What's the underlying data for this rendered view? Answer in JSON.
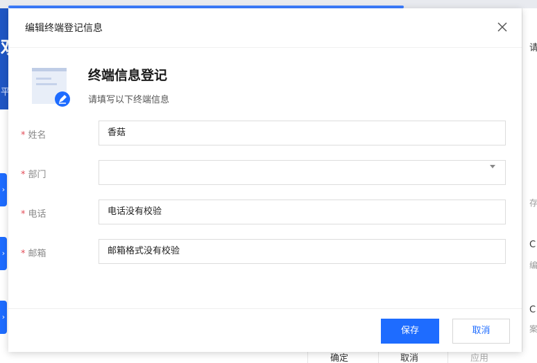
{
  "background": {
    "right_texts": [
      "请",
      "存",
      "C",
      "编",
      "C",
      "案"
    ],
    "bottom_buttons": [
      "确定",
      "取消",
      "应用"
    ],
    "blue_panel_chars": [
      "欢",
      "平"
    ]
  },
  "dialog": {
    "title": "编辑终端登记信息",
    "close_icon": "close-icon",
    "intro": {
      "title": "终端信息登记",
      "subtitle": "请填写以下终端信息",
      "icon": "form-edit-icon"
    },
    "required_mark": "*",
    "fields": {
      "name": {
        "label": "姓名",
        "value": "香菇"
      },
      "department": {
        "label": "部门",
        "value": ""
      },
      "phone": {
        "label": "电话",
        "value": "电话没有校验"
      },
      "email": {
        "label": "邮箱",
        "value": "邮箱格式没有校验"
      }
    },
    "buttons": {
      "save": "保存",
      "cancel": "取消"
    }
  },
  "colors": {
    "primary": "#1e6cff",
    "required": "#e34d59",
    "brand_panel": "#1f56c4"
  }
}
